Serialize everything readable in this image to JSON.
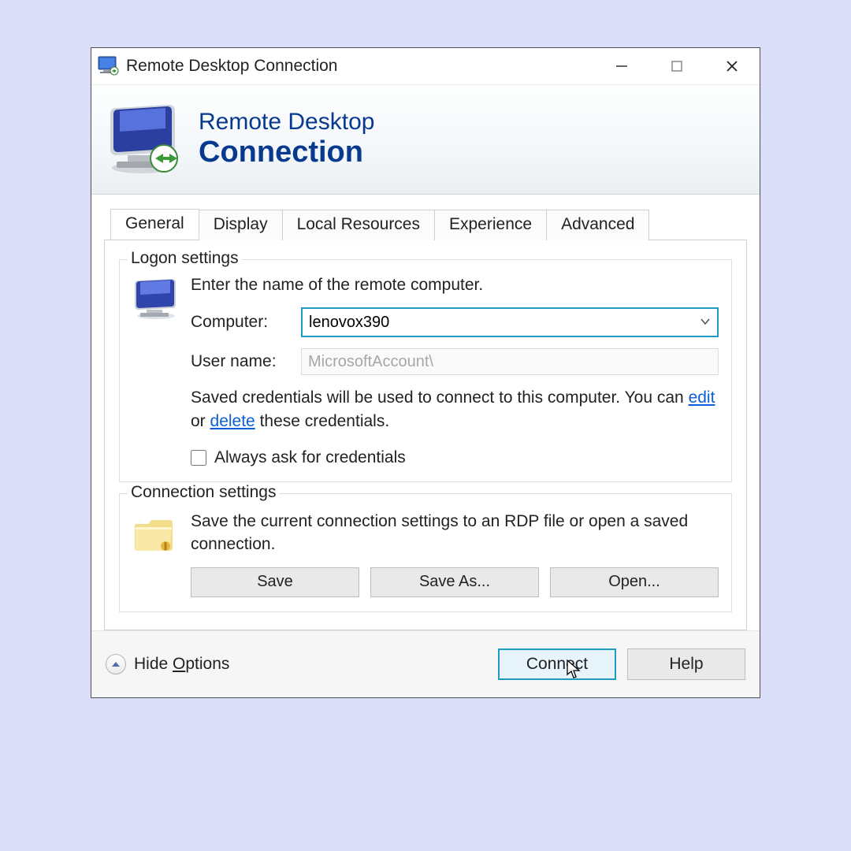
{
  "titlebar": {
    "title": "Remote Desktop Connection"
  },
  "banner": {
    "line1": "Remote Desktop",
    "line2": "Connection"
  },
  "tabs": {
    "general": "General",
    "display": "Display",
    "local_resources": "Local Resources",
    "experience": "Experience",
    "advanced": "Advanced"
  },
  "logon": {
    "legend": "Logon settings",
    "instruction": "Enter the name of the remote computer.",
    "computer_label": "Computer:",
    "computer_value": "lenovox390",
    "username_label": "User name:",
    "username_value": "MicrosoftAccount\\",
    "cred_text_before": "Saved credentials will be used to connect to this computer. You can ",
    "edit_link": "edit",
    "or_text": " or ",
    "delete_link": "delete",
    "cred_text_after": " these credentials.",
    "always_ask": "Always ask for credentials"
  },
  "connection": {
    "legend": "Connection settings",
    "desc": "Save the current connection settings to an RDP file or open a saved connection.",
    "save": "Save",
    "save_as": "Save As...",
    "open": "Open..."
  },
  "bottom": {
    "hide_options_prefix": "Hide ",
    "hide_options_underlined": "O",
    "hide_options_suffix": "ptions",
    "connect": "Connect",
    "help": "Help"
  }
}
